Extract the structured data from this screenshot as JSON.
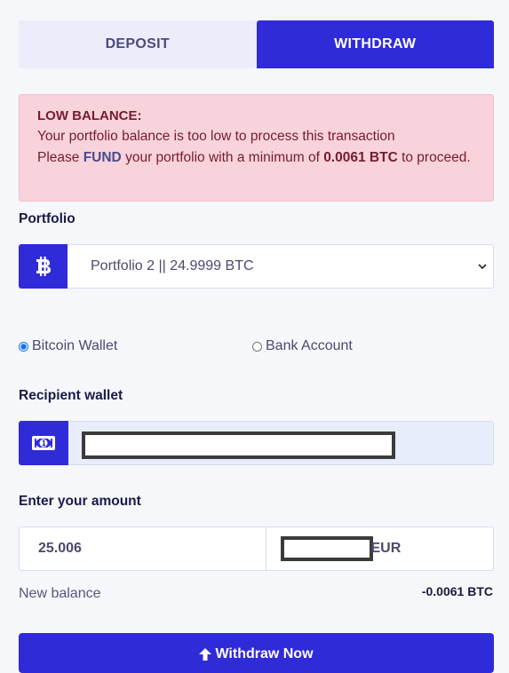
{
  "tabs": [
    {
      "label": "DEPOSIT",
      "active": false
    },
    {
      "label": "WITHDRAW",
      "active": true
    }
  ],
  "alert": {
    "title": "LOW BALANCE:",
    "line1": "Your portfolio balance is too low to process this transaction",
    "line2_pre": "Please ",
    "line2_fund": "FUND",
    "line2_mid": " your portfolio with a minimum of ",
    "line2_amount": "0.0061 BTC",
    "line2_post": " to proceed."
  },
  "portfolio": {
    "label": "Portfolio",
    "icon": "bitcoin-icon",
    "selected": "Portfolio 2 || 24.9999 BTC"
  },
  "method": {
    "options": [
      {
        "label": "Bitcoin Wallet",
        "checked": true
      },
      {
        "label": "Bank Account",
        "checked": false
      }
    ]
  },
  "recipient": {
    "label": "Recipient wallet",
    "icon": "money-bill-icon",
    "value": "[redacted]"
  },
  "amount": {
    "label": "Enter your amount",
    "btc_value": "25.006",
    "fiat_value": "[redacted]",
    "fiat_currency": "EUR"
  },
  "new_balance": {
    "label": "New balance",
    "value": "-0.0061 BTC"
  },
  "submit": {
    "label": "Withdraw Now",
    "icon": "arrow-up-icon"
  },
  "colors": {
    "primary": "#302bd8",
    "alert_bg": "#f8d3dc",
    "alert_text": "#761b2e"
  }
}
